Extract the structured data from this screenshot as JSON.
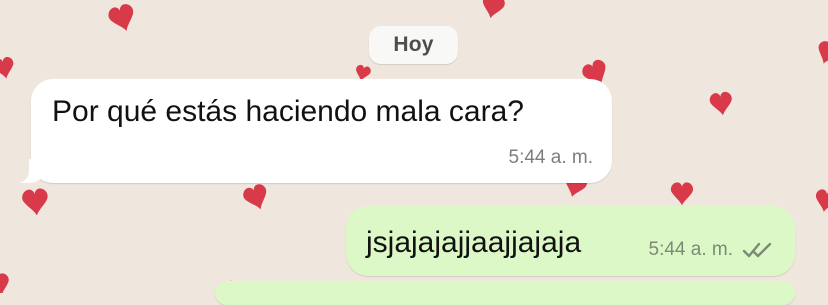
{
  "chat": {
    "date_label": "Hoy",
    "messages": [
      {
        "direction": "incoming",
        "text": "Por qué estás haciendo mala cara?",
        "time": "5:44 a. m."
      },
      {
        "direction": "outgoing",
        "text": "jsjajajajjaajjajaja",
        "time": "5:44 a. m.",
        "status_icon": "double-check-icon"
      }
    ]
  },
  "theme": {
    "background": "#efe7dd",
    "incoming_bubble": "#ffffff",
    "outgoing_bubble": "#dcf8c6",
    "heart_color": "#d62b3c"
  }
}
